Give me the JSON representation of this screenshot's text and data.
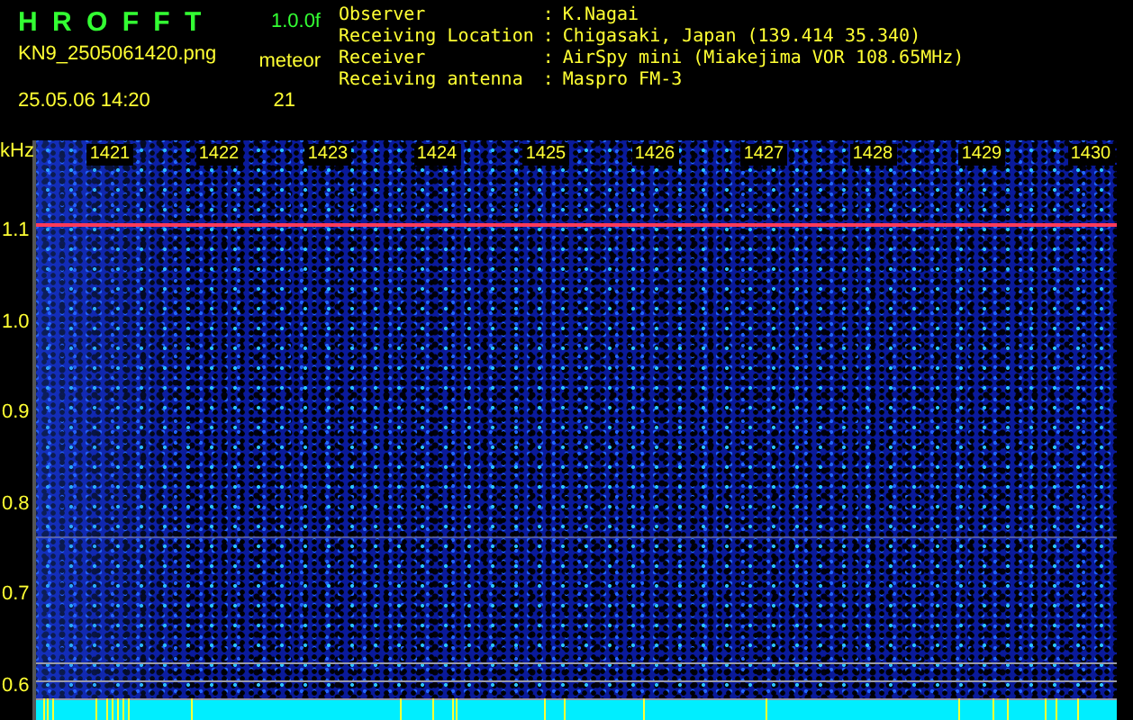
{
  "header": {
    "app_title": "H R O F F T",
    "version": "1.0.0f",
    "filename": "KN9_2505061420.png",
    "timestamp": "25.05.06 14:20",
    "count_label": "meteor",
    "count": "21"
  },
  "info": [
    {
      "label": "Observer",
      "separator": ":",
      "value": "K.Nagai"
    },
    {
      "label": "Receiving Location",
      "separator": ":",
      "value": "Chigasaki, Japan (139.414 35.340)"
    },
    {
      "label": "Receiver",
      "separator": ":",
      "value": "AirSpy mini (Miakejima VOR 108.65MHz)"
    },
    {
      "label": "Receiving antenna",
      "separator": ":",
      "value": "Maspro FM-3"
    }
  ],
  "spectrogram": {
    "unit": "kHz",
    "time_labels": [
      "1421",
      "1422",
      "1423",
      "1424",
      "1425",
      "1426",
      "1427",
      "1428",
      "1429",
      "1430"
    ],
    "frequency_labels": [
      "1.1",
      "1.0",
      "0.9",
      "0.8",
      "0.7",
      "0.6"
    ]
  }
}
